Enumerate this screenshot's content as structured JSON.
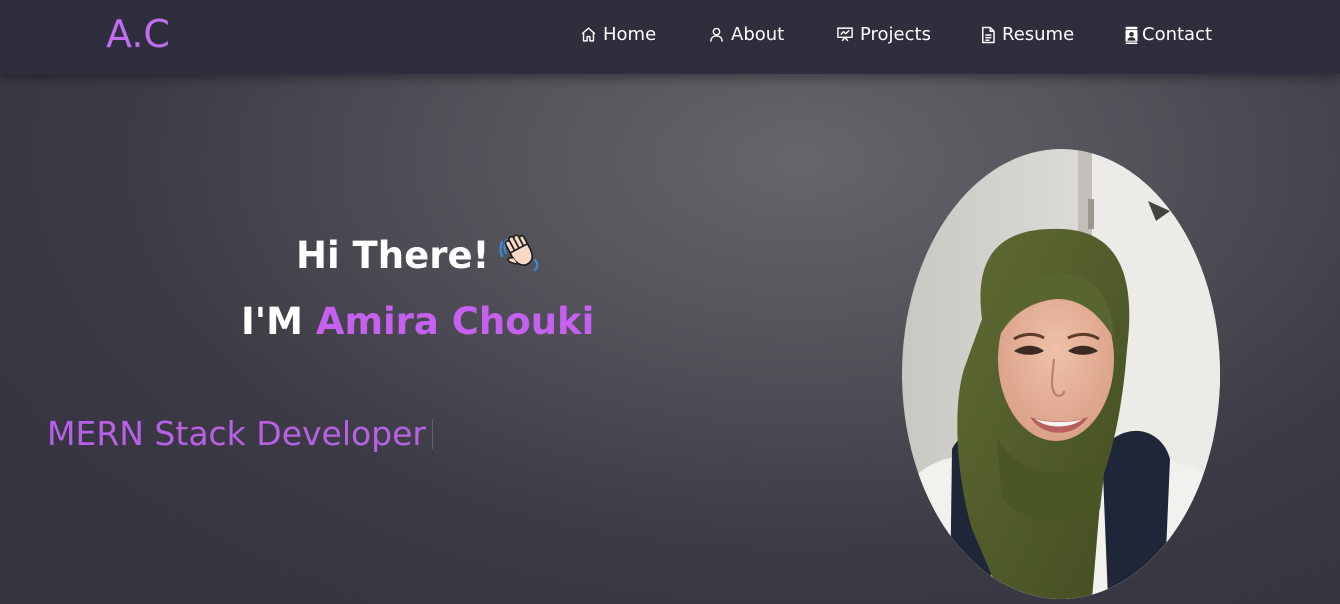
{
  "brand": {
    "logo_text": "A.C"
  },
  "nav": {
    "items": [
      {
        "label": "Home",
        "icon": "home-icon"
      },
      {
        "label": "About",
        "icon": "user-icon"
      },
      {
        "label": "Projects",
        "icon": "presentation-icon"
      },
      {
        "label": "Resume",
        "icon": "document-icon"
      },
      {
        "label": "Contact",
        "icon": "contact-card-icon"
      }
    ]
  },
  "hero": {
    "greeting": "Hi There!",
    "wave_icon": "waving-hand-icon",
    "intro_prefix": "I'M",
    "name": "Amira Chouki",
    "typed_role": "MERN Stack Developer",
    "portrait_icon": "profile-photo"
  },
  "colors": {
    "accent": "#c26cf0",
    "navbar_bg": "#2f2e3c",
    "text": "#ffffff",
    "role_text": "#b861e6"
  }
}
